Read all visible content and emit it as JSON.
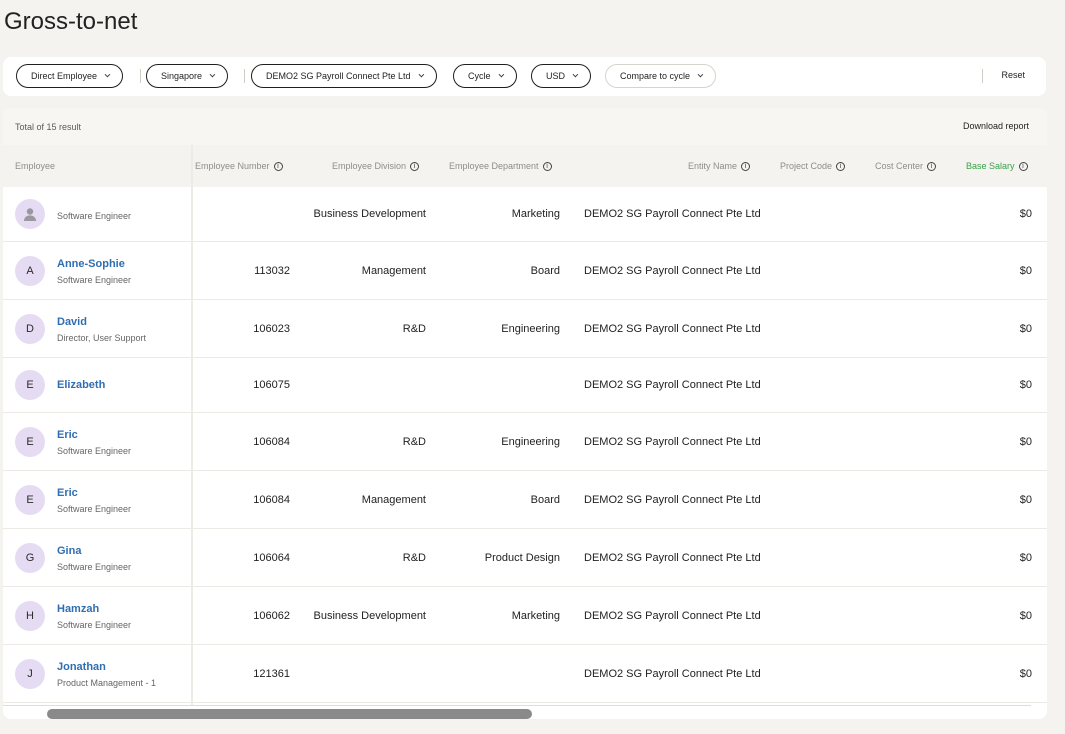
{
  "page": {
    "title": "Gross-to-net"
  },
  "filters": {
    "worker_type": "Direct Employee",
    "country": "Singapore",
    "entity": "DEMO2 SG Payroll Connect Pte Ltd",
    "cycle": "Cycle",
    "currency": "USD",
    "compare": "Compare to cycle",
    "reset": "Reset"
  },
  "table": {
    "total": "Total of 15 result",
    "download": "Download report",
    "columns": {
      "employee": "Employee",
      "employee_number": "Employee Number",
      "division": "Employee Division",
      "department": "Employee Department",
      "entity": "Entity Name",
      "project": "Project Code",
      "cost_center": "Cost Center",
      "base_salary": "Base Salary"
    },
    "rows": [
      {
        "initial": "",
        "name": "",
        "role": "Software Engineer",
        "number": "",
        "division": "Business Development",
        "department": "Marketing",
        "entity": "DEMO2 SG Payroll Connect Pte Ltd",
        "salary": "$0"
      },
      {
        "initial": "A",
        "name": "Anne-Sophie",
        "role": "Software Engineer",
        "number": "113032",
        "division": "Management",
        "department": "Board",
        "entity": "DEMO2 SG Payroll Connect Pte Ltd",
        "salary": "$0"
      },
      {
        "initial": "D",
        "name": "David",
        "role": "Director, User Support",
        "number": "106023",
        "division": "R&D",
        "department": "Engineering",
        "entity": "DEMO2 SG Payroll Connect Pte Ltd",
        "salary": "$0"
      },
      {
        "initial": "E",
        "name": "Elizabeth",
        "role": "",
        "number": "106075",
        "division": "",
        "department": "",
        "entity": "DEMO2 SG Payroll Connect Pte Ltd",
        "salary": "$0"
      },
      {
        "initial": "E",
        "name": "Eric",
        "role": "Software Engineer",
        "number": "106084",
        "division": "R&D",
        "department": "Engineering",
        "entity": "DEMO2 SG Payroll Connect Pte Ltd",
        "salary": "$0"
      },
      {
        "initial": "E",
        "name": "Eric",
        "role": "Software Engineer",
        "number": "106084",
        "division": "Management",
        "department": "Board",
        "entity": "DEMO2 SG Payroll Connect Pte Ltd",
        "salary": "$0"
      },
      {
        "initial": "G",
        "name": "Gina",
        "role": "Software Engineer",
        "number": "106064",
        "division": "R&D",
        "department": "Product Design",
        "entity": "DEMO2 SG Payroll Connect Pte Ltd",
        "salary": "$0"
      },
      {
        "initial": "H",
        "name": "Hamzah",
        "role": "Software Engineer",
        "number": "106062",
        "division": "Business Development",
        "department": "Marketing",
        "entity": "DEMO2 SG Payroll Connect Pte Ltd",
        "salary": "$0"
      },
      {
        "initial": "J",
        "name": "Jonathan",
        "role": "Product Management - 1",
        "number": "121361",
        "division": "",
        "department": "",
        "entity": "DEMO2 SG Payroll Connect Pte Ltd",
        "salary": "$0"
      }
    ]
  },
  "icons": {
    "info": "info-icon",
    "chevron": "chevron-down-icon",
    "avatar_placeholder": "user-icon"
  },
  "colors": {
    "link": "#2f6eb0",
    "accent_green": "#3aa14a",
    "avatar_bg": "#e5dcf4"
  }
}
